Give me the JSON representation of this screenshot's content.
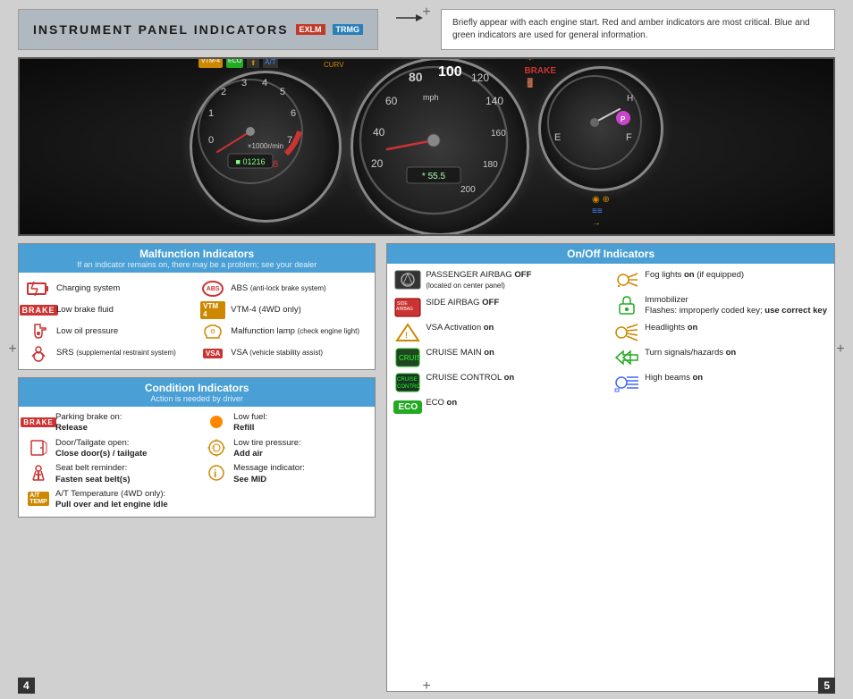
{
  "header": {
    "title": "INSTRUMENT PANEL INDICATORS",
    "badge_exlm": "EXLM",
    "badge_trmg": "TRMG",
    "description": "Briefly appear with each engine start. Red and amber indicators are most critical. Blue and green indicators are used for general information."
  },
  "malfunction_panel": {
    "title": "Malfunction Indicators",
    "subtitle": "If an indicator remains on, there may be a problem; see your dealer",
    "items_left": [
      {
        "icon": "charging-icon",
        "text": "Charging system"
      },
      {
        "icon": "brake-icon",
        "text": "Low brake fluid"
      },
      {
        "icon": "oil-icon",
        "text": "Low oil pressure"
      },
      {
        "icon": "srs-icon",
        "text": "SRS (supplemental restraint system)"
      }
    ],
    "items_right": [
      {
        "icon": "abs-icon",
        "text": "ABS (anti-lock brake system)"
      },
      {
        "icon": "vtm4-icon",
        "text": "VTM-4 (4WD only)"
      },
      {
        "icon": "check-icon",
        "text": "Malfunction lamp (check engine light)"
      },
      {
        "icon": "vsa-icon",
        "text": "VSA (vehicle stability assist)"
      }
    ]
  },
  "condition_panel": {
    "title": "Condition Indicators",
    "subtitle": "Action is needed by driver",
    "items_left": [
      {
        "icon": "parking-brake-icon",
        "label": "Parking brake on:",
        "action": "Release"
      },
      {
        "icon": "door-icon",
        "label": "Door/Tailgate open:",
        "action": "Close door(s) / tailgate"
      },
      {
        "icon": "seatbelt-icon",
        "label": "Seat belt reminder:",
        "action": "Fasten seat belt(s)"
      },
      {
        "icon": "at-temp-icon",
        "label": "A/T Temperature (4WD only):",
        "action": "Pull over and let engine idle"
      }
    ],
    "items_right": [
      {
        "icon": "fuel-icon",
        "label": "Low fuel:",
        "action": "Refill"
      },
      {
        "icon": "tire-icon",
        "label": "Low tire pressure:",
        "action": "Add air"
      },
      {
        "icon": "message-icon",
        "label": "Message indicator:",
        "action": "See MID"
      }
    ]
  },
  "onoff_panel": {
    "title": "On/Off Indicators",
    "items_left": [
      {
        "icon": "passenger-airbag-icon",
        "text": "PASSENGER AIRBAG ",
        "bold": "OFF",
        "sub": "(located on center panel)"
      },
      {
        "icon": "side-airbag-icon",
        "text": "SIDE AIRBAG ",
        "bold": "OFF"
      },
      {
        "icon": "vsa-act-icon",
        "text": "VSA Activation ",
        "bold": "on"
      },
      {
        "icon": "cruise-main-icon",
        "text": "CRUISE MAIN ",
        "bold": "on"
      },
      {
        "icon": "cruise-ctrl-icon",
        "text": "CRUISE CONTROL ",
        "bold": "on"
      },
      {
        "icon": "eco-icon",
        "text": "ECO ",
        "bold": "on"
      }
    ],
    "items_right": [
      {
        "icon": "fog-icon",
        "text": "Fog lights ",
        "bold": "on",
        "suffix": " (if equipped)"
      },
      {
        "icon": "immobilizer-icon",
        "text": "Immobilizer\nFlashes: improperly coded key; ",
        "bold": "use correct key"
      },
      {
        "icon": "headlights-icon",
        "text": "Headlights ",
        "bold": "on"
      },
      {
        "icon": "turn-icon",
        "text": "Turn signals/hazards ",
        "bold": "on"
      },
      {
        "icon": "highbeam-icon",
        "text": "High beams ",
        "bold": "on"
      }
    ]
  },
  "page_numbers": {
    "left": "4",
    "right": "5"
  }
}
